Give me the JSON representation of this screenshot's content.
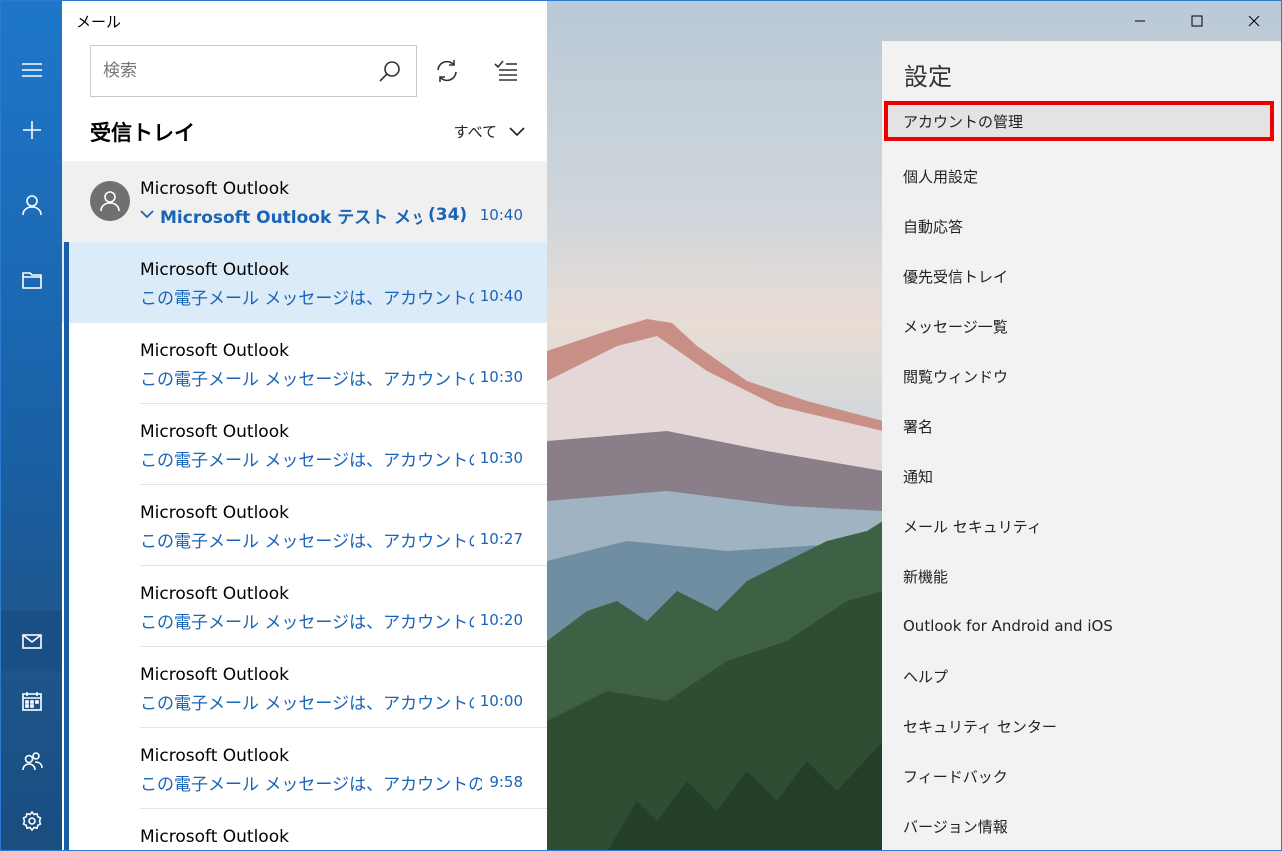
{
  "app": {
    "title": "メール"
  },
  "nav": {
    "items": [
      "menu-icon",
      "new-mail-icon",
      "account-icon",
      "folder-icon",
      "mail-icon",
      "calendar-icon",
      "people-icon",
      "gear-icon"
    ]
  },
  "search": {
    "placeholder": "検索"
  },
  "folder": {
    "title": "受信トレイ",
    "filter_label": "すべて"
  },
  "thread": {
    "sender": "Microsoft Outlook",
    "subject": "Microsoft Outlook テスト メッセー",
    "count": "(34)",
    "time": "10:40"
  },
  "messages": [
    {
      "sender": "Microsoft Outlook",
      "preview": "この電子メール メッセージは、アカウントの設定の",
      "time": "10:40"
    },
    {
      "sender": "Microsoft Outlook",
      "preview": "この電子メール メッセージは、アカウントの設定の",
      "time": "10:30"
    },
    {
      "sender": "Microsoft Outlook",
      "preview": "この電子メール メッセージは、アカウントの設定の",
      "time": "10:30"
    },
    {
      "sender": "Microsoft Outlook",
      "preview": "この電子メール メッセージは、アカウントの設定の",
      "time": "10:27"
    },
    {
      "sender": "Microsoft Outlook",
      "preview": "この電子メール メッセージは、アカウントの設定の",
      "time": "10:20"
    },
    {
      "sender": "Microsoft Outlook",
      "preview": "この電子メール メッセージは、アカウントの設定の",
      "time": "10:00"
    },
    {
      "sender": "Microsoft Outlook",
      "preview": "この電子メール メッセージは、アカウントの設定の",
      "time": "9:58"
    },
    {
      "sender": "Microsoft Outlook",
      "preview": "",
      "time": ""
    }
  ],
  "settings": {
    "title": "設定",
    "items": [
      "アカウントの管理",
      "個人用設定",
      "自動応答",
      "優先受信トレイ",
      "メッセージ一覧",
      "閲覧ウィンドウ",
      "署名",
      "通知",
      "メール セキュリティ",
      "新機能",
      "Outlook for Android and iOS",
      "ヘルプ",
      "セキュリティ センター",
      "フィードバック",
      "バージョン情報"
    ]
  },
  "colors": {
    "nav_bg": "#1e77c9",
    "accent": "#1a64b8",
    "highlight_border": "#ee0000"
  }
}
